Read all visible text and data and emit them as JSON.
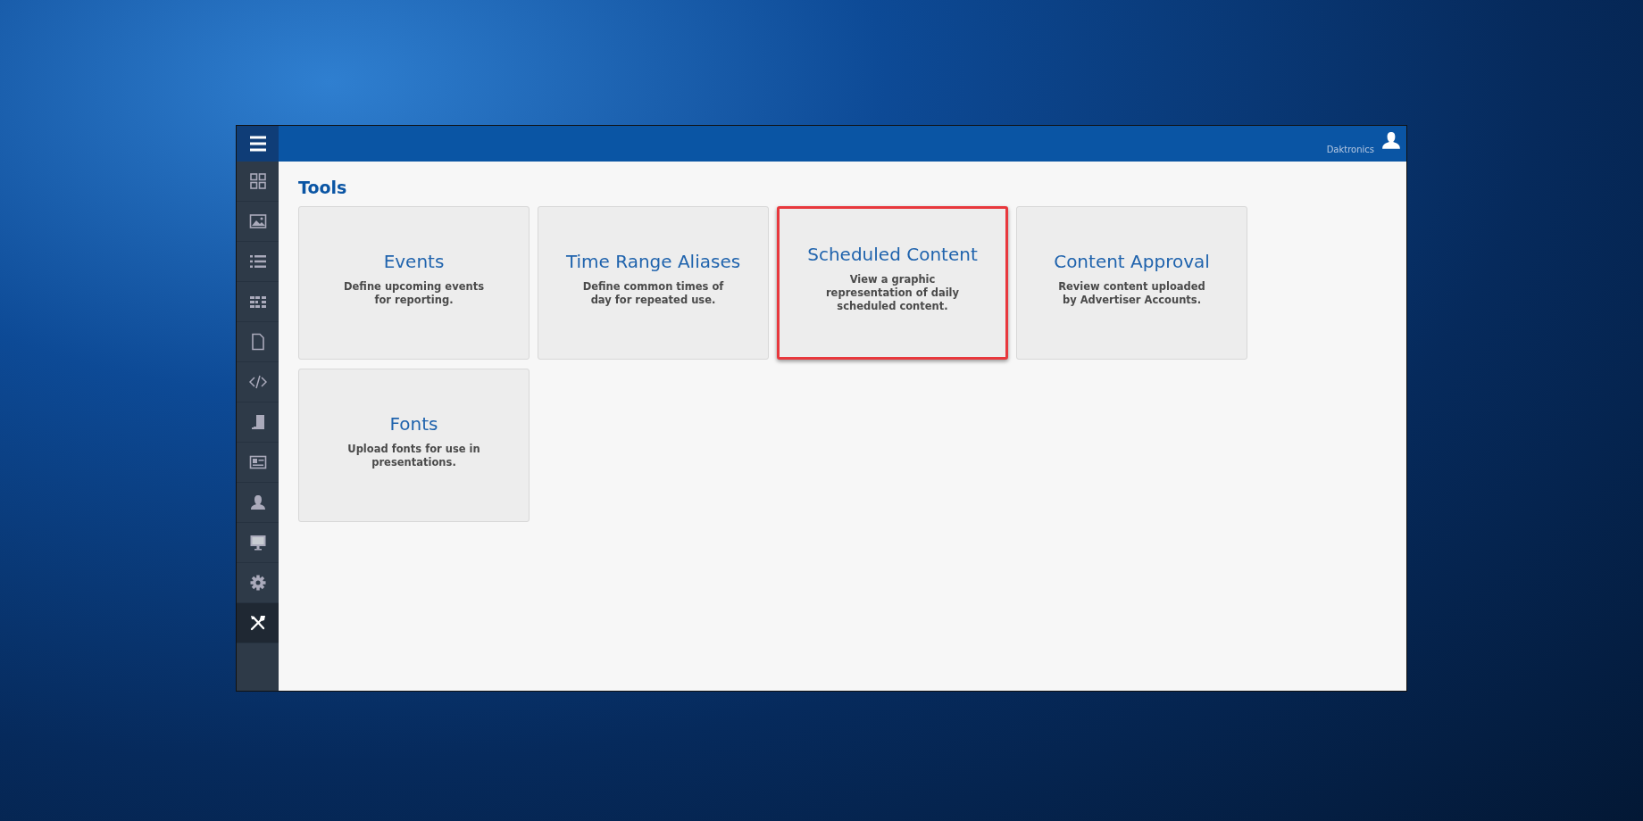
{
  "header": {
    "user_name": "Daktronics"
  },
  "sidebar": {
    "items": [
      {
        "kind": "grid",
        "selected": false
      },
      {
        "kind": "image",
        "selected": false
      },
      {
        "kind": "list",
        "selected": false
      },
      {
        "kind": "layout",
        "selected": false
      },
      {
        "kind": "file",
        "selected": false
      },
      {
        "kind": "code",
        "selected": false
      },
      {
        "kind": "device",
        "selected": false
      },
      {
        "kind": "card",
        "selected": false
      },
      {
        "kind": "user",
        "selected": false
      },
      {
        "kind": "monitor",
        "selected": false
      },
      {
        "kind": "gear",
        "selected": false
      },
      {
        "kind": "tools",
        "selected": true
      }
    ]
  },
  "page_title": "Tools",
  "cards": [
    {
      "title": "Events",
      "description": "Define upcoming events for reporting.",
      "highlighted": false
    },
    {
      "title": "Time Range Aliases",
      "description": "Define common times of day for repeated use.",
      "highlighted": false
    },
    {
      "title": "Scheduled Content",
      "description": "View a graphic representation of daily scheduled content.",
      "highlighted": true
    },
    {
      "title": "Content Approval",
      "description": "Review content uploaded by Advertiser Accounts.",
      "highlighted": false
    },
    {
      "title": "Fonts",
      "description": "Upload fonts for use in presentations.",
      "highlighted": false
    }
  ]
}
